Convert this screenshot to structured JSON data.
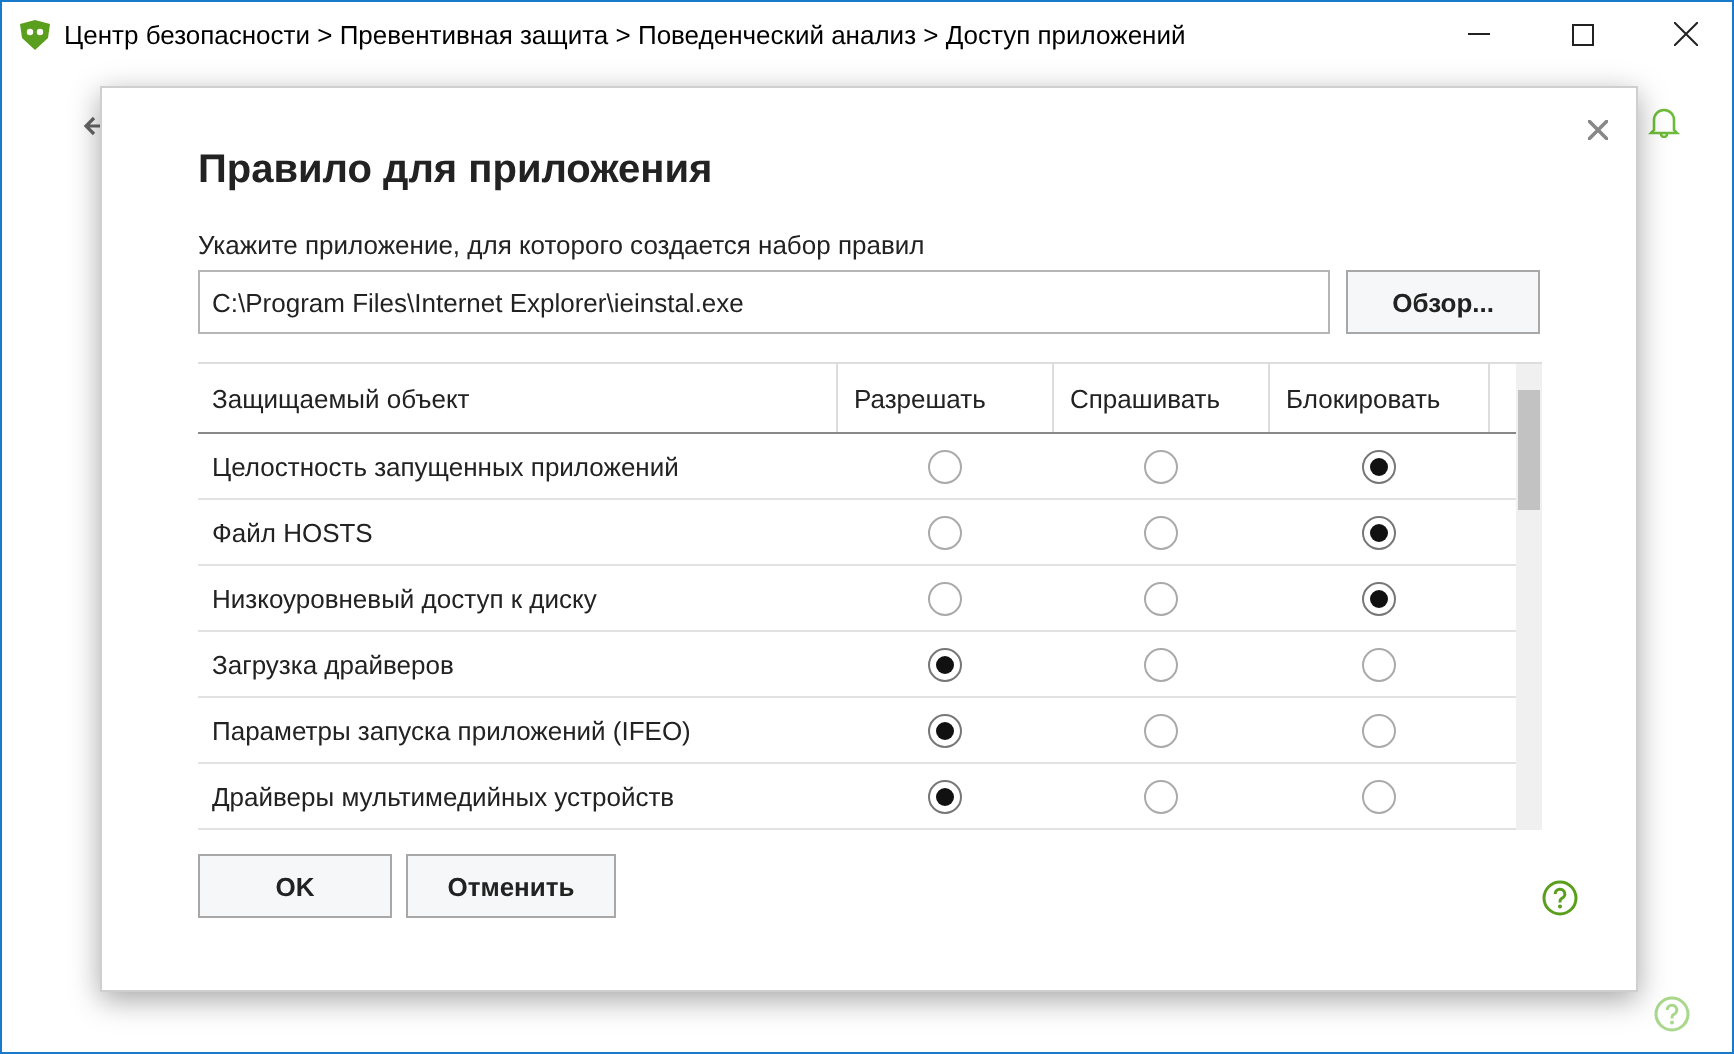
{
  "window": {
    "title": "Центр безопасности > Превентивная защита > Поведенческий анализ > Доступ приложений"
  },
  "dialog": {
    "title": "Правило для приложения",
    "path_label": "Укажите приложение, для которого создается набор правил",
    "path_value": "C:\\Program Files\\Internet Explorer\\ieinstal.exe",
    "browse_button": "Обзор...",
    "table": {
      "columns": [
        "Защищаемый объект",
        "Разрешать",
        "Спрашивать",
        "Блокировать"
      ],
      "rows": [
        {
          "name": "Целостность запущенных приложений",
          "options": [
            {
              "selected": false
            },
            {
              "selected": false
            },
            {
              "selected": true
            }
          ]
        },
        {
          "name": "Файл HOSTS",
          "options": [
            {
              "selected": false
            },
            {
              "selected": false
            },
            {
              "selected": true
            }
          ]
        },
        {
          "name": "Низкоуровневый доступ к диску",
          "options": [
            {
              "selected": false
            },
            {
              "selected": false
            },
            {
              "selected": true
            }
          ]
        },
        {
          "name": "Загрузка драйверов",
          "options": [
            {
              "selected": true
            },
            {
              "selected": false
            },
            {
              "selected": false
            }
          ]
        },
        {
          "name": "Параметры запуска приложений (IFEO)",
          "options": [
            {
              "selected": true
            },
            {
              "selected": false
            },
            {
              "selected": false
            }
          ]
        },
        {
          "name": "Драйверы мультимедийных устройств",
          "options": [
            {
              "selected": true
            },
            {
              "selected": false
            },
            {
              "selected": false
            }
          ]
        }
      ]
    },
    "buttons": [
      "OK",
      "Отменить"
    ]
  }
}
